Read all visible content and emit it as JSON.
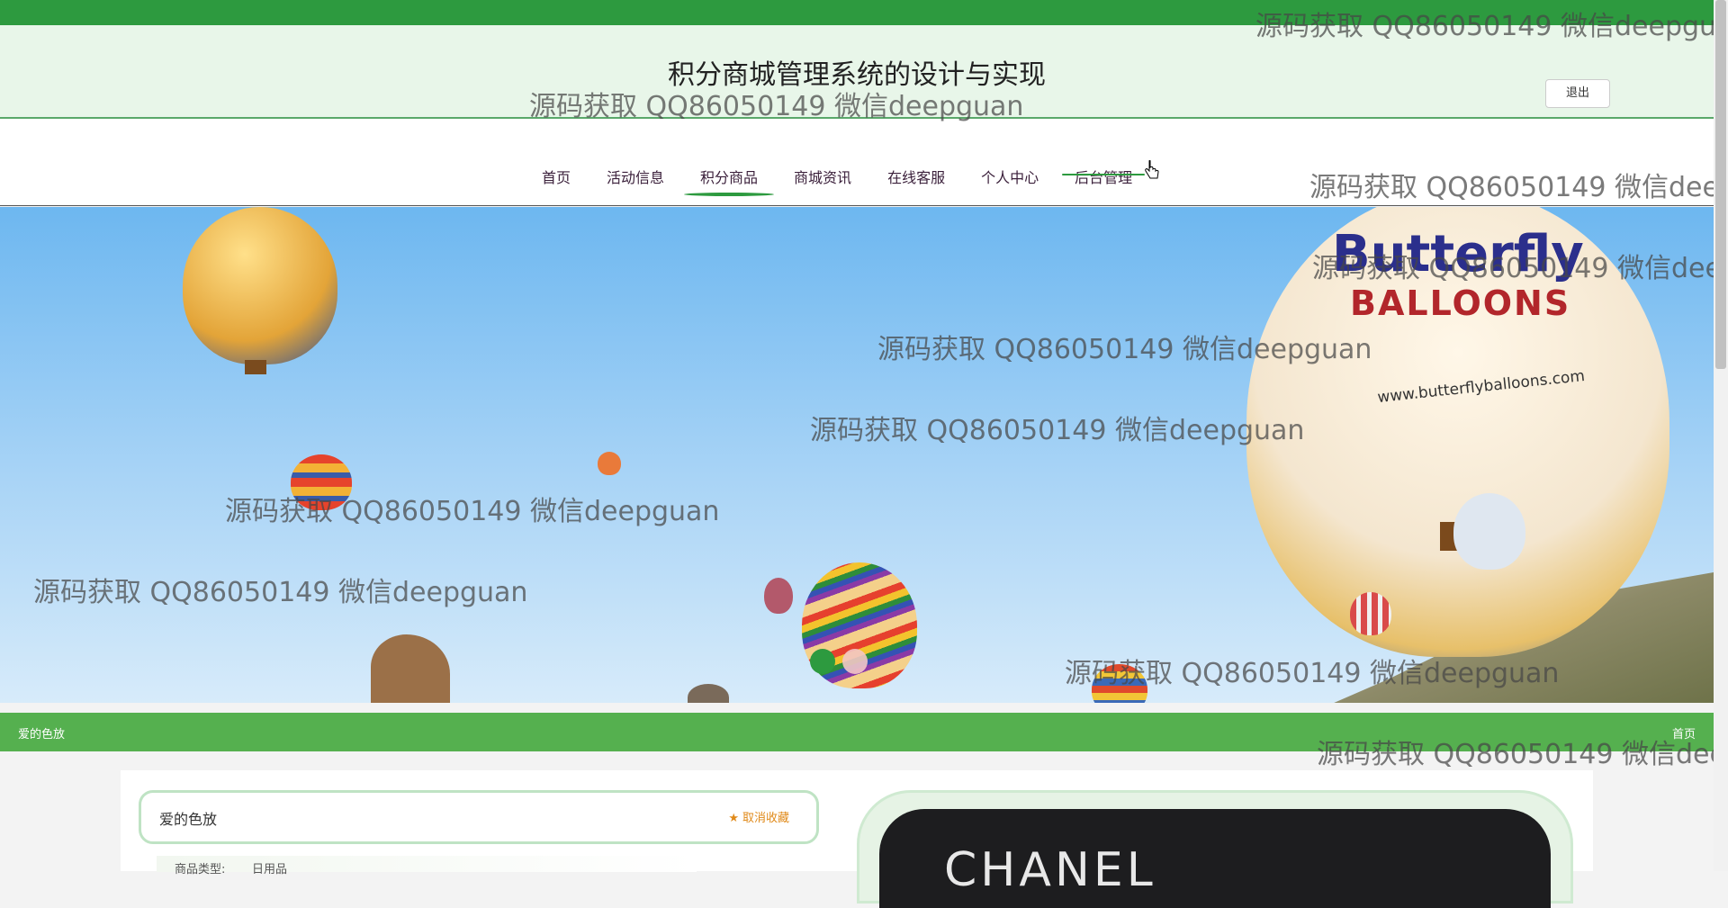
{
  "header": {
    "site_title": "积分商城管理系统的设计与实现",
    "logout_label": "退出"
  },
  "nav": {
    "items": [
      {
        "label": "首页"
      },
      {
        "label": "活动信息"
      },
      {
        "label": "积分商品"
      },
      {
        "label": "商城资讯"
      },
      {
        "label": "在线客服"
      },
      {
        "label": "个人中心"
      },
      {
        "label": "后台管理"
      }
    ],
    "active_index": 2
  },
  "banner": {
    "balloon_text_1": "Butterfly",
    "balloon_text_2": "BALLOONS",
    "balloon_text_3": "www.butterflyballoons.com",
    "small_balloon_text": "Butterfly",
    "active_slide": 1,
    "slide_count": 2
  },
  "breadcrumb": {
    "current": "爱的色放",
    "home_link": "首页"
  },
  "product": {
    "name": "爱的色放",
    "favorite_label": "取消收藏",
    "type_label": "商品类型:",
    "type_value": "日用品",
    "image_text": "CHANEL"
  },
  "watermark": "源码获取 QQ86050149 微信deepguan",
  "colors": {
    "topbar": "#2d9a3f",
    "breadcrumb_bar": "#55b04f",
    "accent": "#e08a1a"
  }
}
